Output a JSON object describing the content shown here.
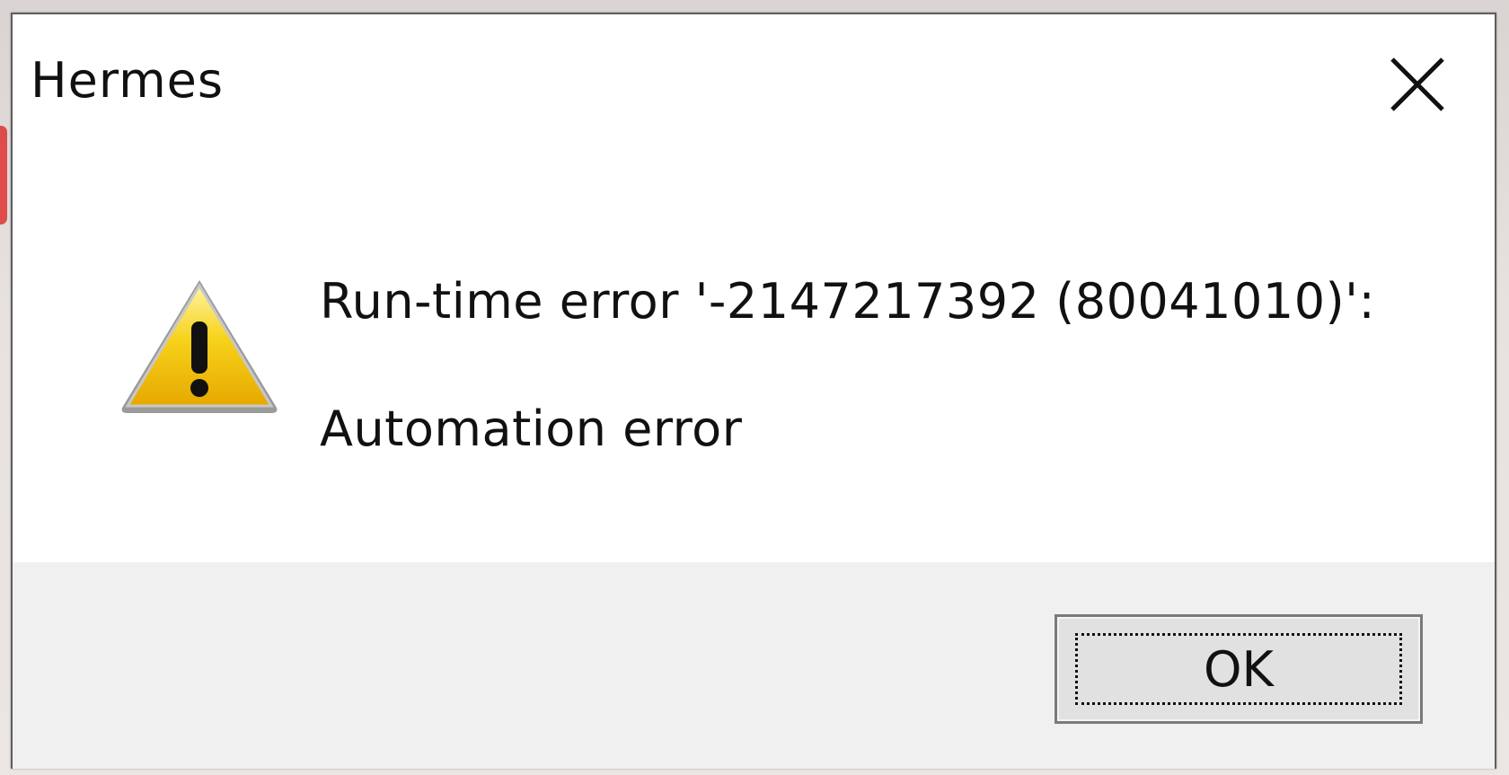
{
  "dialog": {
    "title": "Hermes",
    "close_icon": "close-icon",
    "icon": "warning-icon",
    "message_line1": "Run-time error '-2147217392 (80041010)':",
    "message_line2": "Automation error",
    "ok_label": "OK"
  },
  "colors": {
    "footer_bg": "#f0f0f0",
    "dialog_bg": "#ffffff",
    "warning_yellow": "#f5c400",
    "button_bg": "#e1e1e1"
  }
}
